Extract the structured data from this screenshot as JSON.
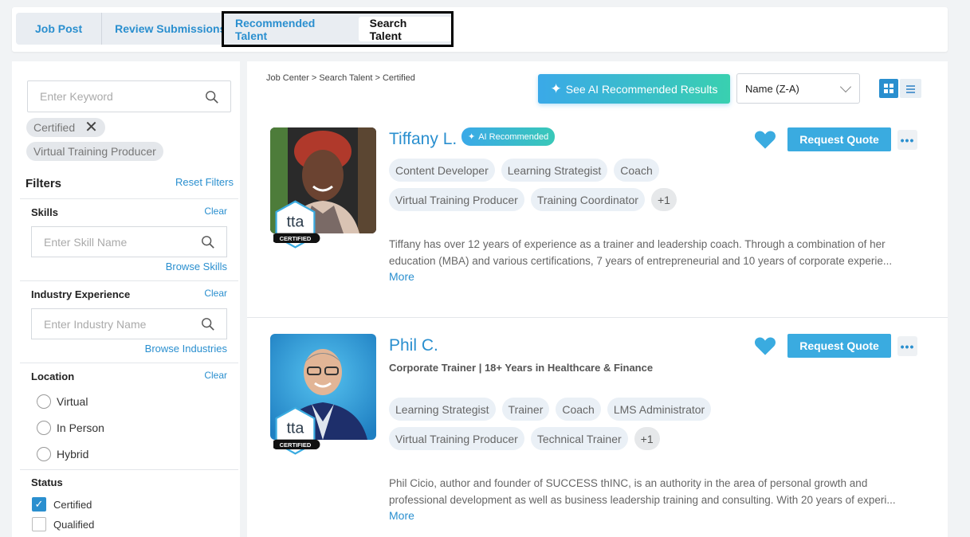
{
  "tabs": {
    "job_post": "Job Post",
    "review_submissions": "Review Submissions",
    "recommended_talent": "Recommended Talent",
    "search_talent": "Search Talent"
  },
  "sidebar": {
    "keyword_placeholder": "Enter Keyword",
    "chips": [
      "Certified",
      "Virtual Training Producer"
    ],
    "filters_title": "Filters",
    "reset_filters": "Reset Filters",
    "skills": {
      "title": "Skills",
      "clear": "Clear",
      "placeholder": "Enter Skill Name",
      "browse": "Browse Skills"
    },
    "industry": {
      "title": "Industry Experience",
      "clear": "Clear",
      "placeholder": "Enter Industry Name",
      "browse": "Browse Industries"
    },
    "location": {
      "title": "Location",
      "clear": "Clear",
      "options": [
        "Virtual",
        "In Person",
        "Hybrid"
      ]
    },
    "status": {
      "title": "Status",
      "options": [
        {
          "label": "Certified",
          "checked": true
        },
        {
          "label": "Qualified",
          "checked": false
        }
      ]
    }
  },
  "main": {
    "breadcrumb": "Job Center > Search Talent > Certified",
    "ai_button": "See AI Recommended Results",
    "sort_value": "Name (Z-A)",
    "accent_color": "#2a8fcf",
    "cards": [
      {
        "name": "Tiffany L.",
        "ai_tag": "AI Recommended",
        "subtitle": "",
        "tags": [
          "Content Developer",
          "Learning Strategist",
          "Coach",
          "Virtual Training Producer",
          "Training Coordinator"
        ],
        "extra_count": "+1",
        "bio": "Tiffany has over 12 years of experience as a trainer and leadership coach. Through a combination of her education (MBA) and various certifications, 7 years of entrepreneurial and 10 years of corporate experie...",
        "more": "More",
        "request_quote": "Request Quote",
        "badge_label": "CERTIFIED",
        "badge_logo": "tta"
      },
      {
        "name": "Phil C.",
        "ai_tag": "",
        "subtitle": "Corporate Trainer | 18+ Years in Healthcare & Finance",
        "tags": [
          "Learning Strategist",
          "Trainer",
          "Coach",
          "LMS Administrator",
          "Virtual Training Producer",
          "Technical Trainer"
        ],
        "extra_count": "+1",
        "bio": "Phil Cicio, author and founder of SUCCESS thINC, is an authority in the area of personal growth and professional development as well as business leadership training and consulting. With 20 years of experi...",
        "more": "More",
        "request_quote": "Request Quote",
        "badge_label": "CERTIFIED",
        "badge_logo": "tta"
      }
    ]
  }
}
